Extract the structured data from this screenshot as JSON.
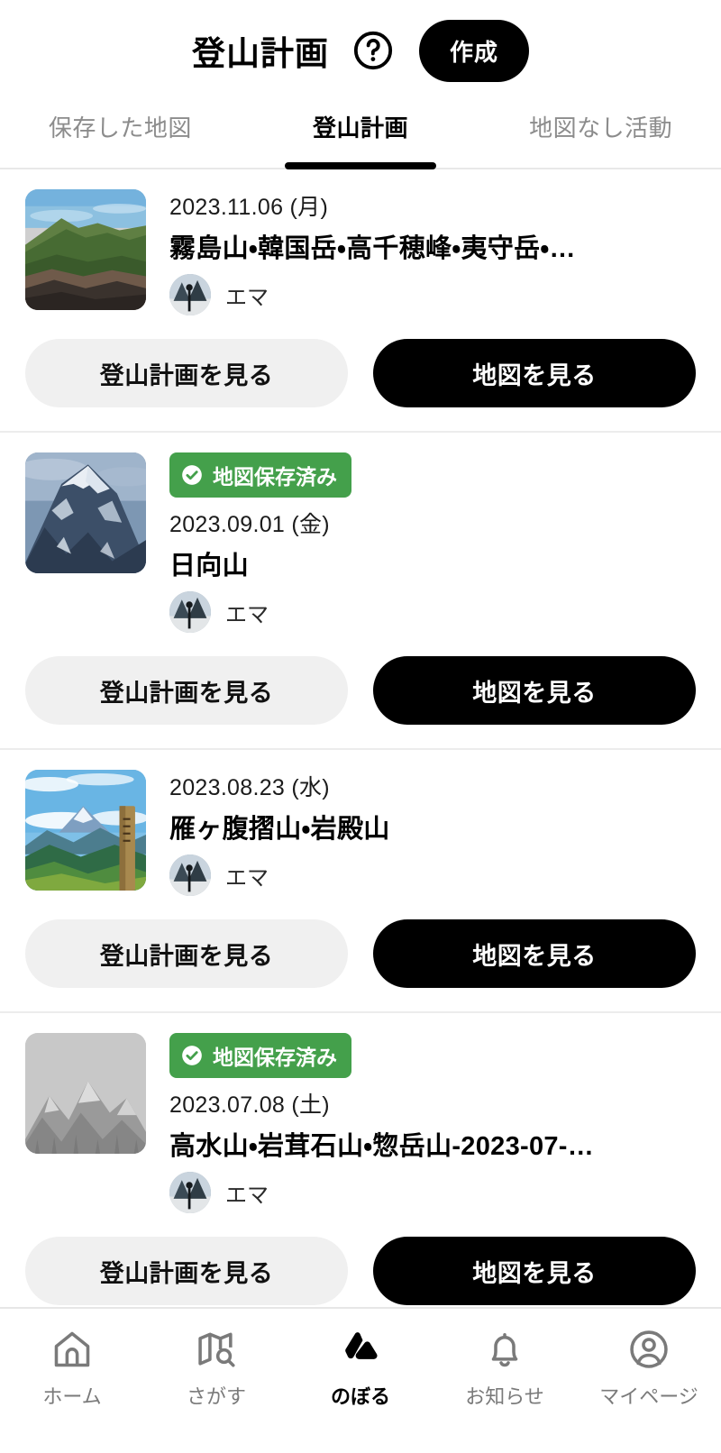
{
  "header": {
    "title": "登山計画",
    "help_icon": "question-circle-icon",
    "create_label": "作成"
  },
  "tabs": [
    {
      "label": "保存した地図",
      "active": false
    },
    {
      "label": "登山計画",
      "active": true
    },
    {
      "label": "地図なし活動",
      "active": false
    }
  ],
  "buttons": {
    "view_plan": "登山計画を見る",
    "view_map": "地図を見る"
  },
  "badge": {
    "saved_map": "地図保存済み",
    "color": "#44a04b",
    "icon": "check-circle-icon"
  },
  "plans": [
    {
      "badge": false,
      "date": "2023.11.06 (月)",
      "title": "霧島山・韓国岳・高千穂峰・夷守岳・…",
      "author": "エマ",
      "thumb": "photo-green-mountain"
    },
    {
      "badge": true,
      "date": "2023.09.01 (金)",
      "title": "日向山",
      "author": "エマ",
      "thumb": "photo-snow-peak"
    },
    {
      "badge": false,
      "date": "2023.08.23 (水)",
      "title": "雁ヶ腹摺山・岩殿山",
      "author": "エマ",
      "thumb": "photo-fuji-signpost"
    },
    {
      "badge": true,
      "date": "2023.07.08 (土)",
      "title": "高水山・岩茸石山・惣岳山-2023-07-…",
      "author": "エマ",
      "thumb": "placeholder-mountain"
    }
  ],
  "bottom_nav": [
    {
      "label": "ホーム",
      "icon": "home-icon",
      "active": false
    },
    {
      "label": "さがす",
      "icon": "map-search-icon",
      "active": false
    },
    {
      "label": "のぼる",
      "icon": "mountain-logo-icon",
      "active": true
    },
    {
      "label": "お知らせ",
      "icon": "bell-icon",
      "active": false
    },
    {
      "label": "マイページ",
      "icon": "account-circle-icon",
      "active": false
    }
  ]
}
